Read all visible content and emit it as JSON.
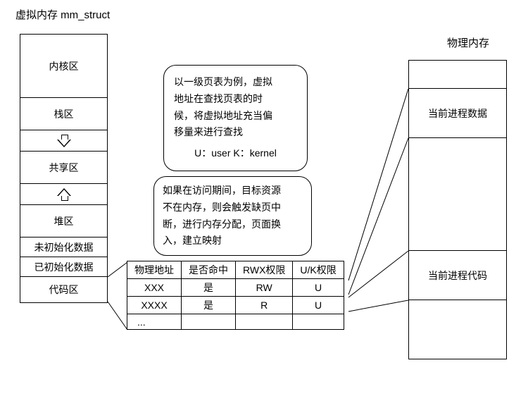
{
  "titles": {
    "vm": "虚拟内存 mm_struct",
    "phys": "物理内存"
  },
  "vm_segments": {
    "kernel": "内核区",
    "stack": "栈区",
    "shared": "共享区",
    "heap": "堆区",
    "bss": "未初始化数据",
    "data": "已初始化数据",
    "code": "代码区"
  },
  "bubbles": {
    "b1_l1": "以一级页表为例，虚拟",
    "b1_l2": "地址在查找页表的时",
    "b1_l3": "候，将虚拟地址充当偏",
    "b1_l4": "移量来进行查找",
    "b1_l5": "U：user  K：kernel",
    "b2_l1": "如果在访问期间，目标资源",
    "b2_l2": "不在内存，则会触发缺页中",
    "b2_l3": "断，进行内存分配，页面换",
    "b2_l4": "入，建立映射"
  },
  "page_table": {
    "headers": {
      "phys_addr": "物理地址",
      "hit": "是否命中",
      "rwx": "RWX权限",
      "uk": "U/K权限"
    },
    "rows": [
      {
        "phys_addr": "XXX",
        "hit": "是",
        "rwx": "RW",
        "uk": "U"
      },
      {
        "phys_addr": "XXXX",
        "hit": "是",
        "rwx": "R",
        "uk": "U"
      },
      {
        "phys_addr": "...",
        "hit": "",
        "rwx": "",
        "uk": ""
      }
    ]
  },
  "phys_mem": {
    "proc_data": "当前进程数据",
    "proc_code": "当前进程代码"
  }
}
